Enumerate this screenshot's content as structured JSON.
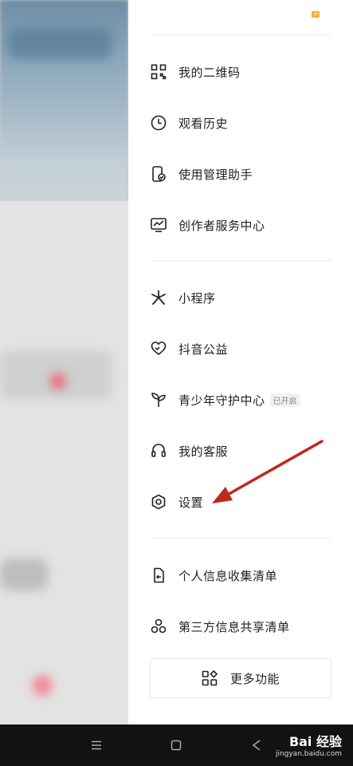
{
  "drawer": {
    "menu_items": [
      {
        "label": "我的二维码",
        "icon": "qr-code-icon"
      },
      {
        "label": "观看历史",
        "icon": "clock-icon"
      },
      {
        "label": "使用管理助手",
        "icon": "phone-check-icon"
      },
      {
        "label": "创作者服务中心",
        "icon": "monitor-chart-icon"
      },
      {
        "label": "小程序",
        "icon": "mini-program-icon"
      },
      {
        "label": "抖音公益",
        "icon": "heart-icon"
      },
      {
        "label": "青少年守护中心",
        "icon": "sprout-icon",
        "badge": "已开启"
      },
      {
        "label": "我的客服",
        "icon": "headset-icon"
      },
      {
        "label": "设置",
        "icon": "settings-hexagon-icon"
      },
      {
        "label": "个人信息收集清单",
        "icon": "document-arrow-icon"
      },
      {
        "label": "第三方信息共享清单",
        "icon": "share-circles-icon"
      }
    ],
    "more_button": {
      "label": "更多功能",
      "icon": "grid-apps-icon"
    }
  },
  "annotation": {
    "color": "#c0281c"
  },
  "navbar": {
    "buttons": [
      "menu-icon",
      "home-square-icon",
      "back-icon"
    ]
  },
  "watermark": {
    "main": "Bai 经验",
    "sub": "jingyan.baidu.com"
  }
}
